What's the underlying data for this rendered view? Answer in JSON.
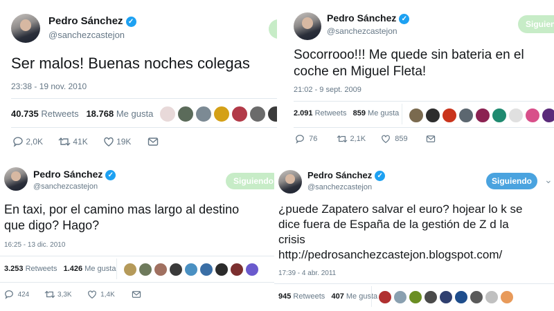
{
  "tweets": [
    {
      "name": "Pedro Sánchez",
      "handle": "@sanchezcastejon",
      "follow_label": "",
      "text_lines": [
        "Ser malos! Buenas noches colegas"
      ],
      "timestamp": "23:38 - 19 nov. 2010",
      "retweets_count": "40.735",
      "retweets_label": "Retweets",
      "likes_count": "18.768",
      "likes_label": "Me gusta",
      "avatar_colors": [
        "#e8d9d9",
        "#5b6b5a",
        "#7c8a94",
        "#d4a017",
        "#b23a48",
        "#6b6b6b",
        "#3b3b3b",
        "#9a6b4e"
      ],
      "replies": "2,0K",
      "retweets_short": "41K",
      "likes_short": "19K"
    },
    {
      "name": "Pedro Sánchez",
      "handle": "@sanchezcastejon",
      "follow_label": "Siguiendo",
      "text_lines": [
        "Socorrooo!!! Me quede sin bateria en el",
        "coche en Miguel Fleta!"
      ],
      "timestamp": "21:02 - 9 sept. 2009",
      "retweets_count": "2.091",
      "retweets_label": "Retweets",
      "likes_count": "859",
      "likes_label": "Me gusta",
      "avatar_colors": [
        "#7a6a4f",
        "#2d2d2d",
        "#c9341c",
        "#5c6770",
        "#8b2252",
        "#1f8a70",
        "#e0e0e0",
        "#d84f8a",
        "#5a2a7a"
      ],
      "replies": "76",
      "retweets_short": "2,1K",
      "likes_short": "859"
    },
    {
      "name": "Pedro Sánchez",
      "handle": "@sanchezcastejon",
      "follow_label": "Siguiendo",
      "text_lines": [
        "En taxi, por el camino mas largo al destino",
        "que digo? Hago?"
      ],
      "timestamp": "16:25 - 13 dic. 2010",
      "retweets_count": "3.253",
      "retweets_label": "Retweets",
      "likes_count": "1.426",
      "likes_label": "Me gusta",
      "avatar_colors": [
        "#b59a5a",
        "#6e7a5c",
        "#a07060",
        "#3a3a3a",
        "#4a90c2",
        "#3a6ea5",
        "#2b2b2b",
        "#7b2f2f",
        "#6a5acd"
      ],
      "replies": "424",
      "retweets_short": "3,3K",
      "likes_short": "1,4K"
    },
    {
      "name": "Pedro Sánchez",
      "handle": "@sanchezcastejon",
      "follow_label": "Siguiendo",
      "text_lines": [
        "¿puede Zapatero salvar el euro? hojear lo k se",
        "dice fuera de España de la gestión de Z d la",
        "crisis",
        "http://pedrosanchezcastejon.blogspot.com/"
      ],
      "timestamp": "17:39 - 4 abr. 2011",
      "retweets_count": "945",
      "retweets_label": "Retweets",
      "likes_count": "407",
      "likes_label": "Me gusta",
      "avatar_colors": [
        "#b03030",
        "#8aa0b0",
        "#6b8e23",
        "#4a4a4a",
        "#2f3f6f",
        "#1e4d8c",
        "#5a5a5a",
        "#c0c0c0",
        "#e89a5a"
      ]
    }
  ],
  "colors": {
    "accent": "#1da1f2",
    "follow_green": "#c7ecc7",
    "follow_blue": "#4aa3df",
    "text": "#14171a",
    "muted": "#657786"
  }
}
